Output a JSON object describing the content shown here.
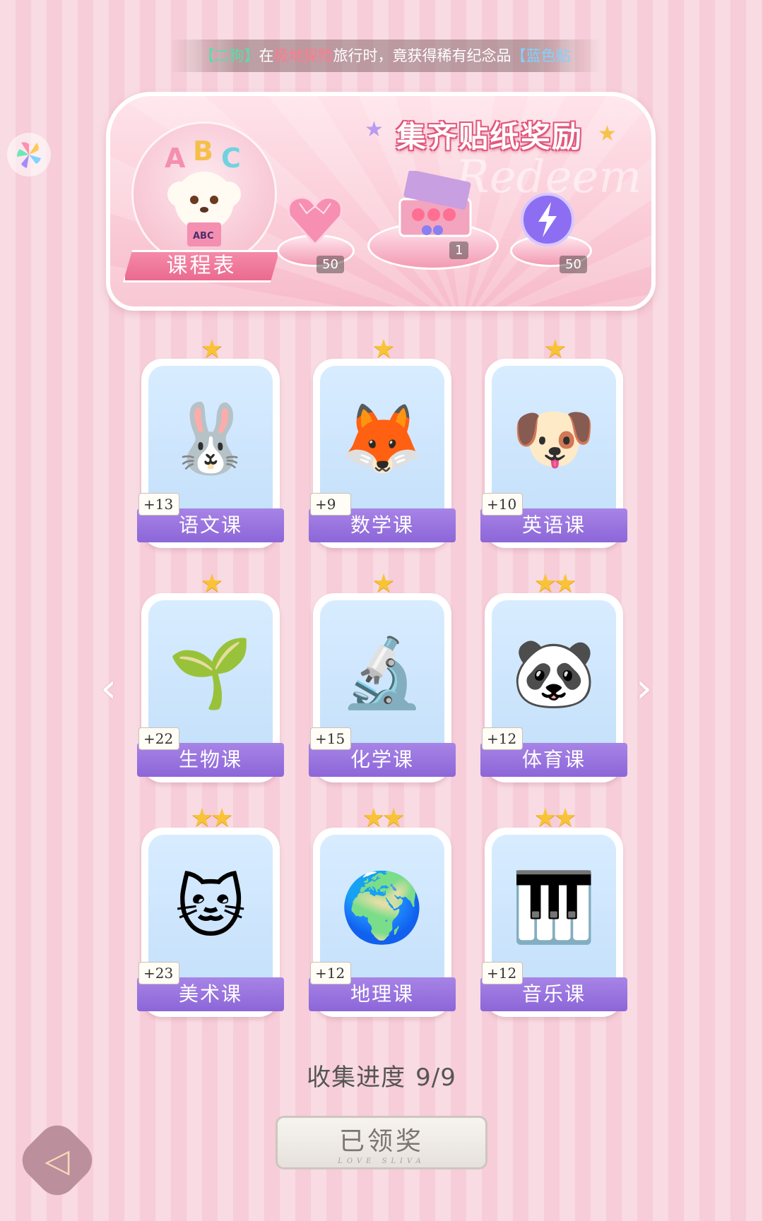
{
  "ticker": {
    "part1": "【二狗】",
    "part2": "在",
    "part3": "极地探险",
    "part4": "旅行时，竟获得稀有纪念品",
    "part5": "【蓝色贴"
  },
  "banner": {
    "title": "集齐贴纸奖励",
    "watermark": "Redeem",
    "course_label": "课程表",
    "rewards": [
      {
        "icon": "pink-heart-gem",
        "count": "50"
      },
      {
        "icon": "gift-box",
        "count": "1"
      },
      {
        "icon": "purple-lightning-orb",
        "count": "50"
      }
    ]
  },
  "stickers": [
    {
      "name": "语文课",
      "count": "+13",
      "stars": "★",
      "icon": "🐰"
    },
    {
      "name": "数学课",
      "count": "+9",
      "stars": "★",
      "icon": "🦊"
    },
    {
      "name": "英语课",
      "count": "+10",
      "stars": "★",
      "icon": "🐶"
    },
    {
      "name": "生物课",
      "count": "+22",
      "stars": "★",
      "icon": "🌱"
    },
    {
      "name": "化学课",
      "count": "+15",
      "stars": "★",
      "icon": "🔬"
    },
    {
      "name": "体育课",
      "count": "+12",
      "stars": "★★",
      "icon": "🐼"
    },
    {
      "name": "美术课",
      "count": "+23",
      "stars": "★★",
      "icon": "🐱"
    },
    {
      "name": "地理课",
      "count": "+12",
      "stars": "★★",
      "icon": "🌍"
    },
    {
      "name": "音乐课",
      "count": "+12",
      "stars": "★★",
      "icon": "🎹"
    }
  ],
  "progress": {
    "label": "收集进度",
    "value": "9/9"
  },
  "claim": {
    "label": "已领奖",
    "sub": "LOVE SLIVA"
  },
  "colors": {
    "accent": "#8c66d8",
    "pink": "#f6cdd8",
    "star": "#f9c338"
  }
}
